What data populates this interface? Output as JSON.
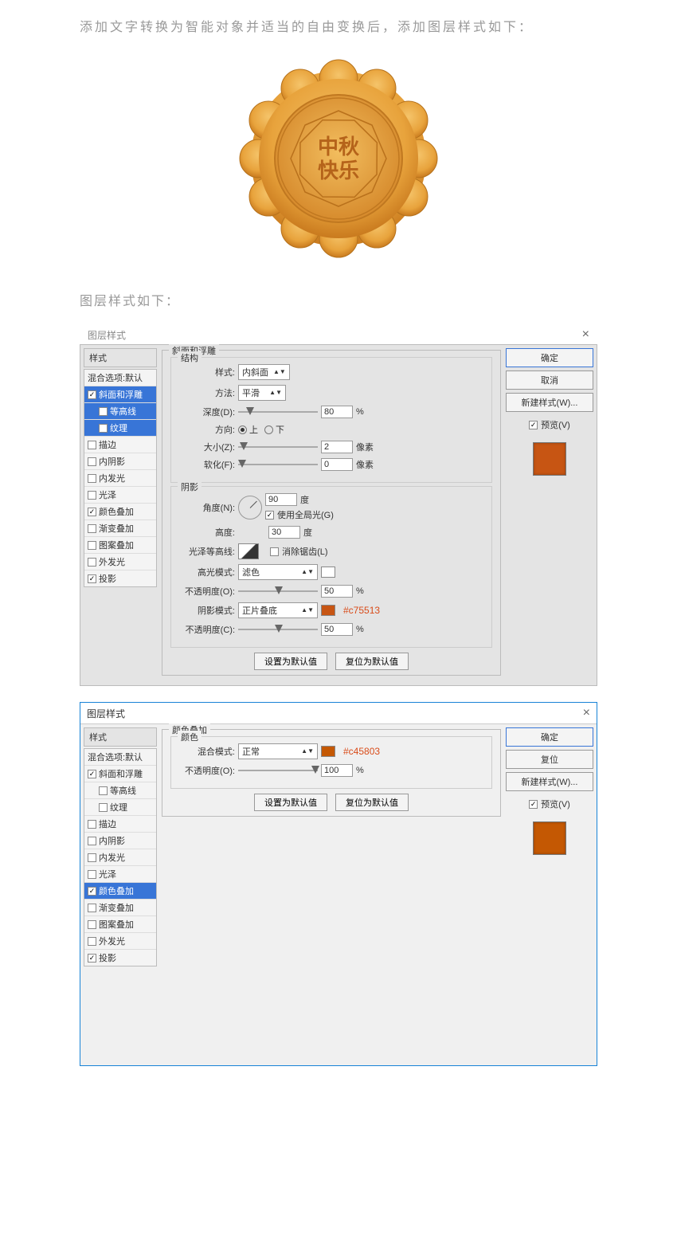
{
  "intro": "添加文字转换为智能对象并适当的自由变换后，添加图层样式如下：",
  "subhead": "图层样式如下：",
  "mooncake_text_top": "中秋",
  "mooncake_text_bottom": "快乐",
  "dialog1": {
    "title": "图层样式",
    "close": "×",
    "styles_header": "样式",
    "blending": "混合选项:默认",
    "effects": [
      {
        "label": "斜面和浮雕",
        "checked": true,
        "selected": true
      },
      {
        "label": "等高线",
        "checked": false,
        "sub": true,
        "selected": true
      },
      {
        "label": "纹理",
        "checked": false,
        "sub": true,
        "selected": true
      },
      {
        "label": "描边",
        "checked": false
      },
      {
        "label": "内阴影",
        "checked": false
      },
      {
        "label": "内发光",
        "checked": false
      },
      {
        "label": "光泽",
        "checked": false
      },
      {
        "label": "颜色叠加",
        "checked": true
      },
      {
        "label": "渐变叠加",
        "checked": false
      },
      {
        "label": "图案叠加",
        "checked": false
      },
      {
        "label": "外发光",
        "checked": false
      },
      {
        "label": "投影",
        "checked": true
      }
    ],
    "panel_title": "斜面和浮雕",
    "structure_title": "结构",
    "style_label": "样式:",
    "style_value": "内斜面",
    "technique_label": "方法:",
    "technique_value": "平滑",
    "depth_label": "深度(D):",
    "depth_value": "80",
    "depth_unit": "%",
    "direction_label": "方向:",
    "up": "上",
    "down": "下",
    "size_label": "大小(Z):",
    "size_value": "2",
    "px": "像素",
    "soften_label": "软化(F):",
    "soften_value": "0",
    "shading_title": "阴影",
    "angle_label": "角度(N):",
    "angle_value": "90",
    "deg": "度",
    "global_light": "使用全局光(G)",
    "altitude_label": "高度:",
    "altitude_value": "30",
    "gloss_label": "光泽等高线:",
    "antialias": "消除锯齿(L)",
    "highlight_mode_label": "高光模式:",
    "highlight_mode_value": "滤色",
    "opacity_label": "不透明度(O):",
    "opacity_value": "50",
    "percent": "%",
    "shadow_mode_label": "阴影模式:",
    "shadow_mode_value": "正片叠底",
    "shadow_color": "#c75513",
    "shadow_hex": "#c75513",
    "opacity2_label": "不透明度(C):",
    "opacity2_value": "50",
    "default_btn": "设置为默认值",
    "reset_btn": "复位为默认值",
    "ok": "确定",
    "cancel": "取消",
    "new_style": "新建样式(W)...",
    "preview": "预览(V)",
    "preview_color": "#c75513"
  },
  "dialog2": {
    "title": "图层样式",
    "close": "×",
    "styles_header": "样式",
    "blending": "混合选项:默认",
    "effects": [
      {
        "label": "斜面和浮雕",
        "checked": true
      },
      {
        "label": "等高线",
        "checked": false,
        "sub": true
      },
      {
        "label": "纹理",
        "checked": false,
        "sub": true
      },
      {
        "label": "描边",
        "checked": false
      },
      {
        "label": "内阴影",
        "checked": false
      },
      {
        "label": "内发光",
        "checked": false
      },
      {
        "label": "光泽",
        "checked": false
      },
      {
        "label": "颜色叠加",
        "checked": true,
        "selected": true
      },
      {
        "label": "渐变叠加",
        "checked": false
      },
      {
        "label": "图案叠加",
        "checked": false
      },
      {
        "label": "外发光",
        "checked": false
      },
      {
        "label": "投影",
        "checked": true
      }
    ],
    "panel_title": "颜色叠加",
    "color_title": "颜色",
    "blend_label": "混合模式:",
    "blend_value": "正常",
    "overlay_color": "#c45803",
    "overlay_hex": "#c45803",
    "opacity_label": "不透明度(O):",
    "opacity_value": "100",
    "percent": "%",
    "default_btn": "设置为默认值",
    "reset_btn": "复位为默认值",
    "ok": "确定",
    "cancel": "复位",
    "new_style": "新建样式(W)...",
    "preview": "预览(V)",
    "preview_color": "#c45803"
  }
}
